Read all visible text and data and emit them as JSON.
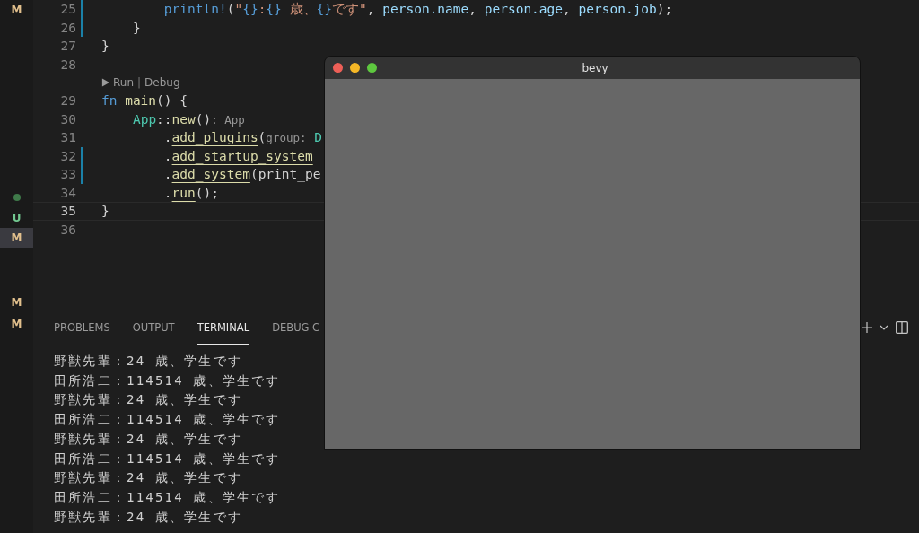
{
  "scm_marks": [
    {
      "kind": "letter",
      "text": "M",
      "color": "#e2c08d",
      "selected": false
    },
    {
      "kind": "dot",
      "color": "#3f7a4a",
      "selected": false
    },
    {
      "kind": "letter",
      "text": "U",
      "color": "#73c991",
      "selected": false
    },
    {
      "kind": "letter",
      "text": "M",
      "color": "#e2c08d",
      "selected": true
    },
    {
      "kind": "letter",
      "text": "M",
      "color": "#e2c08d",
      "selected": false
    },
    {
      "kind": "letter",
      "text": "M",
      "color": "#e2c08d",
      "selected": false
    }
  ],
  "editor": {
    "lines": [
      {
        "number": "25",
        "modified": true,
        "current": false,
        "segments": [
          {
            "kind": "macro",
            "text": "        println!"
          },
          {
            "kind": "punct",
            "text": "("
          },
          {
            "kind": "str",
            "text": "\""
          },
          {
            "kind": "brace",
            "text": "{}"
          },
          {
            "kind": "str",
            "text": ":"
          },
          {
            "kind": "brace",
            "text": "{}"
          },
          {
            "kind": "str",
            "text": " 歳、"
          },
          {
            "kind": "brace",
            "text": "{}"
          },
          {
            "kind": "str",
            "text": "です\""
          },
          {
            "kind": "punct",
            "text": ", "
          },
          {
            "kind": "var",
            "text": "person.name"
          },
          {
            "kind": "punct",
            "text": ", "
          },
          {
            "kind": "var",
            "text": "person.age"
          },
          {
            "kind": "punct",
            "text": ", "
          },
          {
            "kind": "var",
            "text": "person.job"
          },
          {
            "kind": "punct",
            "text": ");"
          }
        ]
      },
      {
        "number": "26",
        "modified": true,
        "current": false,
        "segments": [
          {
            "kind": "punct",
            "text": "    }"
          }
        ]
      },
      {
        "number": "27",
        "modified": false,
        "current": false,
        "segments": [
          {
            "kind": "punct",
            "text": "}"
          }
        ]
      },
      {
        "number": "28",
        "modified": false,
        "current": false
      },
      {
        "number": "29",
        "modified": false,
        "current": false,
        "codelens": {
          "run": "Run",
          "separator": "|",
          "debug": "Debug"
        },
        "segments": [
          {
            "kind": "kw",
            "text": "fn"
          },
          {
            "kind": "fn",
            "text": "main"
          },
          {
            "kind": "punct",
            "text": "() {"
          }
        ]
      },
      {
        "number": "30",
        "modified": false,
        "current": false,
        "segments": [
          {
            "kind": "type",
            "text": "    App"
          },
          {
            "kind": "punct",
            "text": "::"
          },
          {
            "kind": "fn",
            "text": "new"
          },
          {
            "kind": "punct",
            "text": "()"
          },
          {
            "kind": "hint",
            "text": ": App"
          }
        ]
      },
      {
        "number": "31",
        "modified": false,
        "current": false,
        "segments": [
          {
            "kind": "punct",
            "text": "        ."
          },
          {
            "kind": "method",
            "text": "add_plugins"
          },
          {
            "kind": "punct",
            "text": "("
          },
          {
            "kind": "hint",
            "text": "group:"
          },
          {
            "kind": "type",
            "text": "D"
          }
        ]
      },
      {
        "number": "32",
        "modified": true,
        "current": false,
        "segments": [
          {
            "kind": "punct",
            "text": "        ."
          },
          {
            "kind": "method",
            "text": "add_startup_system"
          }
        ]
      },
      {
        "number": "33",
        "modified": true,
        "current": false,
        "segments": [
          {
            "kind": "punct",
            "text": "        ."
          },
          {
            "kind": "method",
            "text": "add_system"
          },
          {
            "kind": "punct",
            "text": "("
          },
          {
            "kind": "plain",
            "text": "print_pe"
          }
        ]
      },
      {
        "number": "34",
        "modified": false,
        "current": false,
        "segments": [
          {
            "kind": "punct",
            "text": "        ."
          },
          {
            "kind": "method",
            "text": "run"
          },
          {
            "kind": "punct",
            "text": "();"
          }
        ]
      },
      {
        "number": "35",
        "modified": false,
        "current": true,
        "segments": [
          {
            "kind": "punct",
            "text": "}"
          }
        ]
      },
      {
        "number": "36",
        "modified": false,
        "current": false
      }
    ]
  },
  "panel": {
    "tabs": [
      {
        "label": "PROBLEMS",
        "selected": false
      },
      {
        "label": "OUTPUT",
        "selected": false
      },
      {
        "label": "TERMINAL",
        "selected": true
      },
      {
        "label": "DEBUG C",
        "selected": false
      }
    ],
    "terminal_lines": [
      "野獣先輩：24 歳、学生です",
      "田所浩二：114514 歳、学生です",
      "野獣先輩：24 歳、学生です",
      "田所浩二：114514 歳、学生です",
      "野獣先輩：24 歳、学生です",
      "田所浩二：114514 歳、学生です",
      "野獣先輩：24 歳、学生です",
      "田所浩二：114514 歳、学生です",
      "野獣先輩：24 歳、学生です"
    ]
  },
  "app_window": {
    "title": "bevy"
  }
}
